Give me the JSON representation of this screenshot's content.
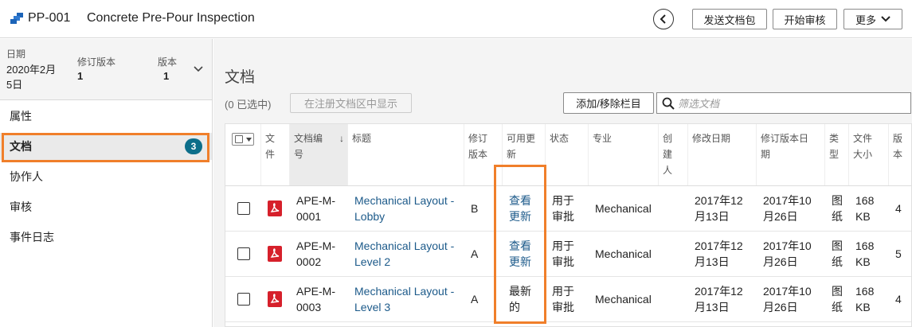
{
  "header": {
    "package_id": "PP-001",
    "package_title": "Concrete Pre-Pour Inspection",
    "send_button": "发送文档包",
    "review_button": "开始审核",
    "more_button": "更多"
  },
  "sidebar": {
    "meta": {
      "date_label": "日期",
      "date_value_line1": "2020年2月",
      "date_value_line2": "5日",
      "revision_label": "修订版本",
      "revision_value": "1",
      "version_label": "版本",
      "version_value": "1"
    },
    "items": [
      {
        "label": "属性"
      },
      {
        "label": "文档",
        "badge": "3",
        "active": true
      },
      {
        "label": "协作人"
      },
      {
        "label": "审核"
      },
      {
        "label": "事件日志"
      }
    ]
  },
  "main": {
    "section_title": "文档",
    "selected_count": "(0 已选中)",
    "show_in_register_button": "在注册文档区中显示",
    "columns_button": "添加/移除栏目",
    "filter_placeholder": "筛选文档",
    "columns": {
      "file": [
        "文",
        "件"
      ],
      "doc_no": [
        "文档编",
        "号"
      ],
      "title": [
        "标题"
      ],
      "revision": [
        "修订",
        "版本"
      ],
      "updates": [
        "可用更",
        "新"
      ],
      "status": [
        "状态"
      ],
      "discipline": [
        "专业"
      ],
      "creator": [
        "创",
        "建",
        "人"
      ],
      "modified": [
        "修改日期"
      ],
      "rev_date": [
        "修订版本日",
        "期"
      ],
      "type": [
        "类",
        "型"
      ],
      "size": [
        "文件",
        "大小"
      ],
      "version": [
        "版",
        "本"
      ]
    },
    "rows": [
      {
        "doc_no": [
          "APE-M-",
          "0001"
        ],
        "title": [
          "Mechanical Layout -",
          "Lobby"
        ],
        "revision": "B",
        "updates": [
          "查看",
          "更新"
        ],
        "updates_link": true,
        "status": [
          "用于",
          "审批"
        ],
        "discipline": "Mechanical",
        "modified": [
          "2017年12",
          "月13日"
        ],
        "rev_date": [
          "2017年10",
          "月26日"
        ],
        "type": [
          "图",
          "纸"
        ],
        "size": [
          "168",
          "KB"
        ],
        "version": "4"
      },
      {
        "doc_no": [
          "APE-M-",
          "0002"
        ],
        "title": [
          "Mechanical Layout -",
          "Level 2"
        ],
        "revision": "A",
        "updates": [
          "查看",
          "更新"
        ],
        "updates_link": true,
        "status": [
          "用于",
          "审批"
        ],
        "discipline": "Mechanical",
        "modified": [
          "2017年12",
          "月13日"
        ],
        "rev_date": [
          "2017年10",
          "月26日"
        ],
        "type": [
          "图",
          "纸"
        ],
        "size": [
          "168",
          "KB"
        ],
        "version": "5"
      },
      {
        "doc_no": [
          "APE-M-",
          "0003"
        ],
        "title": [
          "Mechanical Layout -",
          "Level 3"
        ],
        "revision": "A",
        "updates": [
          "最新",
          "的"
        ],
        "updates_link": false,
        "status": [
          "用于",
          "审批"
        ],
        "discipline": "Mechanical",
        "modified": [
          "2017年12",
          "月13日"
        ],
        "rev_date": [
          "2017年10",
          "月26日"
        ],
        "type": [
          "图",
          "纸"
        ],
        "size": [
          "168",
          "KB"
        ],
        "version": "4"
      }
    ]
  },
  "colors": {
    "accent_badge": "#0c6e8a",
    "link": "#1c5a8a",
    "highlight": "#f07f2a",
    "pdf_icon": "#d6202b"
  },
  "icons": {
    "logo": "logo-icon",
    "back": "chevron-left-icon",
    "more": "chevron-down-icon",
    "meta_toggle": "chevron-down-icon",
    "filter": "search-icon",
    "file": "pdf-icon"
  }
}
